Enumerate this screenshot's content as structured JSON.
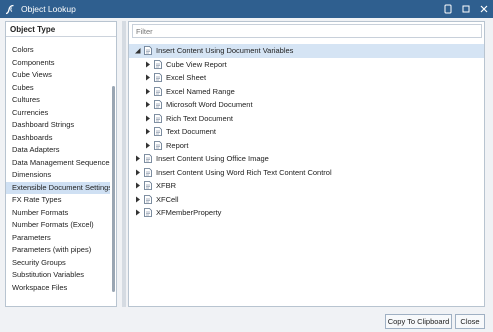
{
  "window": {
    "title": "Object Lookup",
    "title_icon": "onestream-logo-icon",
    "controls": [
      "restore-icon",
      "maximize-icon",
      "close-icon"
    ],
    "title_color": "#2f5f8f"
  },
  "left_panel": {
    "header": "Object Type",
    "items": [
      {
        "label": "Colors"
      },
      {
        "label": "Components"
      },
      {
        "label": "Cube Views"
      },
      {
        "label": "Cubes"
      },
      {
        "label": "Cultures"
      },
      {
        "label": "Currencies"
      },
      {
        "label": "Dashboard Strings"
      },
      {
        "label": "Dashboards"
      },
      {
        "label": "Data Adapters"
      },
      {
        "label": "Data Management Sequences"
      },
      {
        "label": "Dimensions"
      },
      {
        "label": "Extensible Document Settings",
        "selected": true
      },
      {
        "label": "FX Rate Types"
      },
      {
        "label": "Number Formats"
      },
      {
        "label": "Number Formats (Excel)"
      },
      {
        "label": "Parameters"
      },
      {
        "label": "Parameters (with pipes)"
      },
      {
        "label": "Security Groups"
      },
      {
        "label": "Substitution Variables"
      },
      {
        "label": "Workspace Files"
      }
    ]
  },
  "right_panel": {
    "filter_placeholder": "Filter",
    "tree": [
      {
        "label": "Insert Content Using Document Variables",
        "level": 0,
        "expander": "expanded",
        "selected": true
      },
      {
        "label": "Cube View Report",
        "level": 1,
        "expander": "collapsed"
      },
      {
        "label": "Excel Sheet",
        "level": 1,
        "expander": "collapsed"
      },
      {
        "label": "Excel Named Range",
        "level": 1,
        "expander": "collapsed"
      },
      {
        "label": "Microsoft Word Document",
        "level": 1,
        "expander": "collapsed"
      },
      {
        "label": "Rich Text Document",
        "level": 1,
        "expander": "collapsed"
      },
      {
        "label": "Text Document",
        "level": 1,
        "expander": "collapsed"
      },
      {
        "label": "Report",
        "level": 1,
        "expander": "collapsed"
      },
      {
        "label": "Insert Content Using Office Image",
        "level": 0,
        "expander": "collapsed"
      },
      {
        "label": "Insert Content Using Word Rich Text Content Control",
        "level": 0,
        "expander": "collapsed"
      },
      {
        "label": "XFBR",
        "level": 0,
        "expander": "collapsed"
      },
      {
        "label": "XFCell",
        "level": 0,
        "expander": "collapsed"
      },
      {
        "label": "XFMemberProperty",
        "level": 0,
        "expander": "collapsed"
      }
    ]
  },
  "buttons": {
    "copy_label": "Copy To Clipboard",
    "close_label": "Close"
  }
}
